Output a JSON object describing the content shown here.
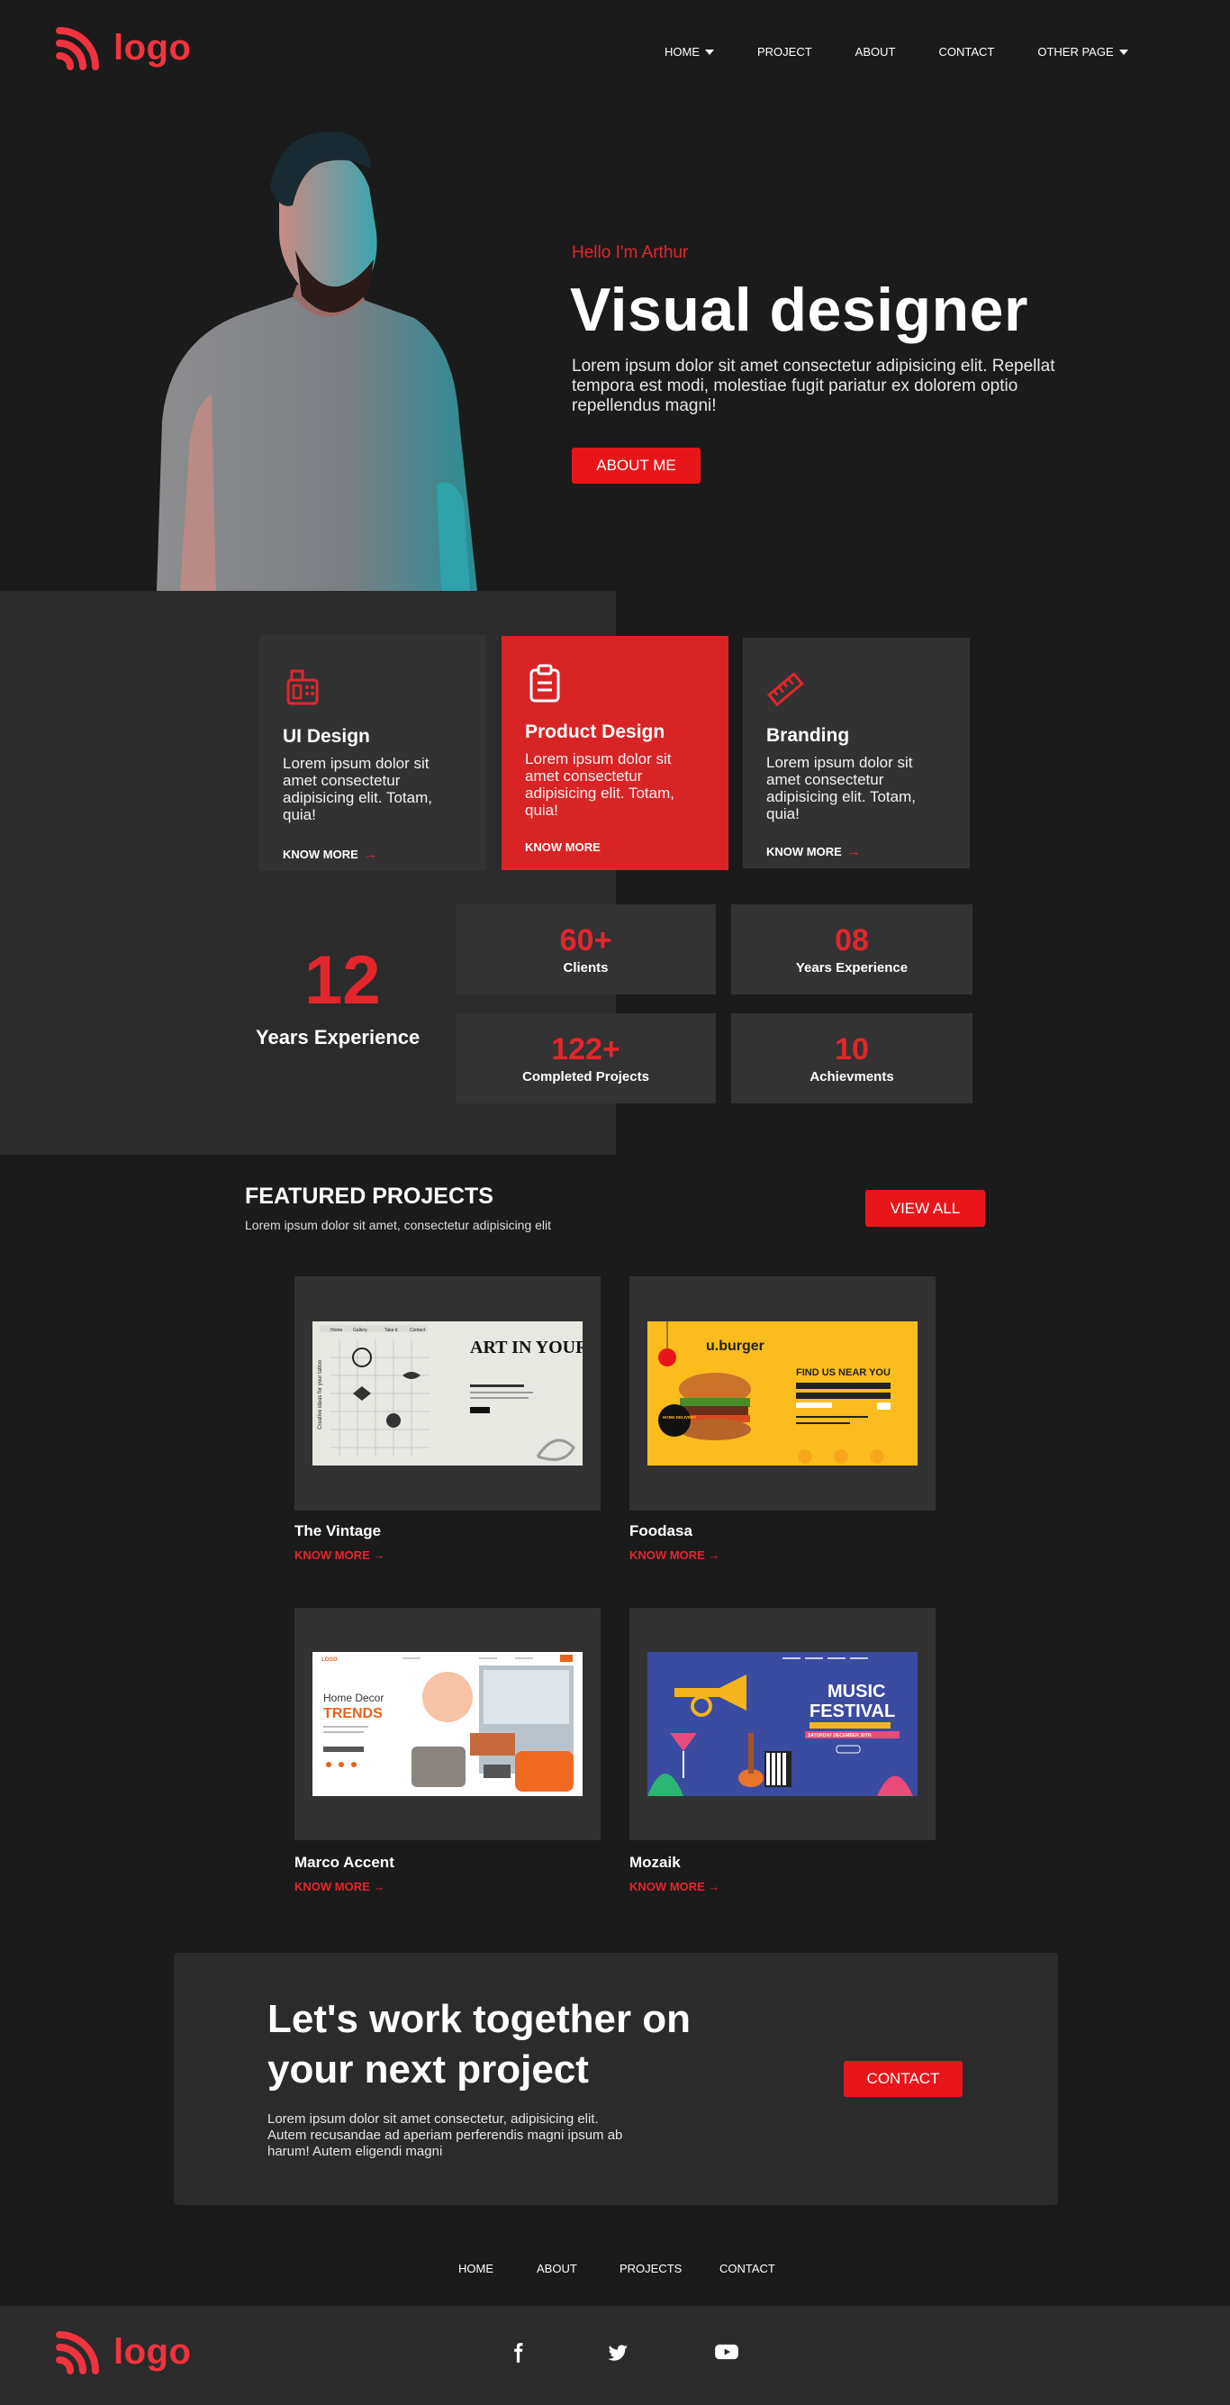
{
  "header": {
    "logo_text": "logo",
    "nav": [
      {
        "label": "HOME",
        "dropdown": true
      },
      {
        "label": "PROJECT",
        "dropdown": false
      },
      {
        "label": "ABOUT",
        "dropdown": false
      },
      {
        "label": "CONTACT",
        "dropdown": false
      },
      {
        "label": "OTHER PAGE",
        "dropdown": true
      }
    ]
  },
  "hero": {
    "hello": "Hello I'm Arthur",
    "title": "Visual designer",
    "description": "Lorem ipsum dolor sit amet consectetur adipisicing elit. Repellat tempora est modi, molestiae fugit pariatur ex dolorem optio repellendus magni!",
    "button": "ABOUT ME"
  },
  "services": [
    {
      "icon": "fax-icon",
      "title": "UI Design",
      "text": "Lorem ipsum dolor sit amet consectetur adipisicing elit. Totam, quia!",
      "link": "KNOW MORE",
      "highlight": false
    },
    {
      "icon": "clipboard-icon",
      "title": "Product Design",
      "text": "Lorem ipsum dolor sit amet consectetur adipisicing elit. Totam, quia!",
      "link": "KNOW MORE",
      "highlight": true
    },
    {
      "icon": "ruler-pencil-icon",
      "title": "Branding",
      "text": "Lorem ipsum dolor sit amet consectetur adipisicing elit. Totam, quia!",
      "link": "KNOW MORE",
      "highlight": false
    }
  ],
  "experience": {
    "number": "12",
    "label": "Years Experience"
  },
  "stats": [
    {
      "value": "60+",
      "label": "Clients"
    },
    {
      "value": "08",
      "label": "Years Experience"
    },
    {
      "value": "122+",
      "label": "Completed Projects"
    },
    {
      "value": "10",
      "label": "Achievments"
    }
  ],
  "featured": {
    "title": "FEATURED PROJECTS",
    "subtitle": "Lorem ipsum dolor sit amet, consectetur adipisicing elit",
    "view_all": "VIEW ALL",
    "projects": [
      {
        "name": "The Vintage",
        "link": "KNOW MORE",
        "shot": {
          "headline": "ART IN YOUR SKIN",
          "side": "Creative ideas for your tattoo",
          "nav": [
            "Home",
            "Gallery",
            "Take it",
            "Contact"
          ]
        }
      },
      {
        "name": "Foodasa",
        "link": "KNOW MORE",
        "shot": {
          "brand": "u.burger",
          "headline": "FIND US NEAR YOU",
          "badge": "HOME DELIVERY"
        }
      },
      {
        "name": "Marco Accent",
        "link": "KNOW MORE",
        "shot": {
          "brand": "LOGO",
          "line1": "Home Decor",
          "line2": "TRENDS"
        }
      },
      {
        "name": "Mozaik",
        "link": "KNOW MORE",
        "shot": {
          "line1": "MUSIC",
          "line2": "FESTIVAL",
          "date": "SATURDAY DECEMBER 30TH"
        }
      }
    ]
  },
  "cta": {
    "title_line1": "Let's work together on",
    "title_line2": "your next project",
    "text": "Lorem ipsum dolor sit amet consectetur, adipisicing elit. Autem recusandae ad aperiam perferendis magni ipsum ab harum! Autem eligendi magni",
    "button": "CONTACT"
  },
  "footer": {
    "nav": [
      "HOME",
      "ABOUT",
      "PROJECTS",
      "CONTACT"
    ],
    "logo_text": "logo",
    "social": [
      "facebook-icon",
      "twitter-icon",
      "youtube-icon"
    ]
  },
  "colors": {
    "accent": "#e3262c",
    "background": "#1b1b1c",
    "panel": "#2b2b2c",
    "card": "#323233",
    "logo": "#f0343f"
  }
}
